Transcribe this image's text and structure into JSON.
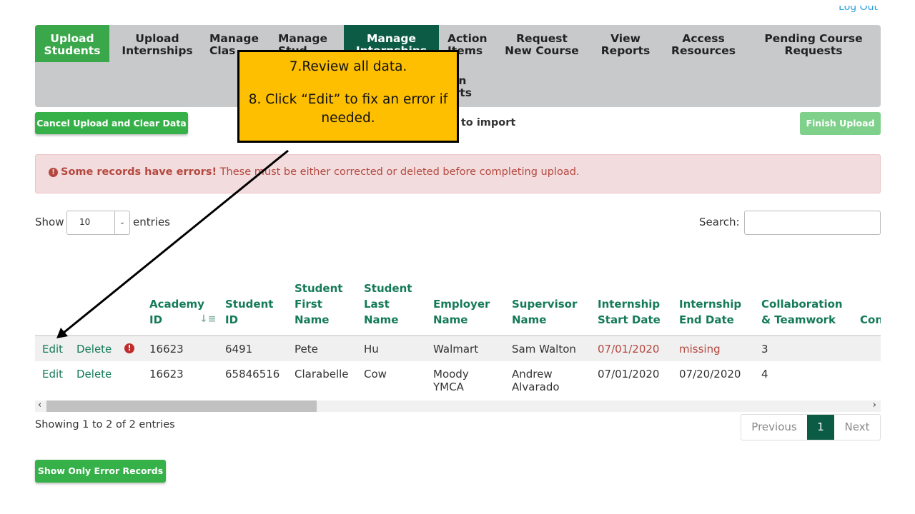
{
  "header": {
    "logout": "Log Out"
  },
  "nav": [
    {
      "label": "Upload\nStudents",
      "state": "active"
    },
    {
      "label": "Upload\nInternships"
    },
    {
      "label": "Manage\nClas"
    },
    {
      "label": "Manage\nStud"
    },
    {
      "label": "Manage\nInternships",
      "state": "current"
    },
    {
      "label": "Action\nItems"
    },
    {
      "label": "Request\nNew Course"
    },
    {
      "label": "View\nReports"
    },
    {
      "label": "Access\nResources"
    },
    {
      "label": "Pending Course\nRequests"
    },
    {
      "label": "nin\norts"
    }
  ],
  "toolbar": {
    "cancel_label": "Cancel Upload and Clear Data",
    "status_text": "dy to import",
    "finish_label": "Finish Upload"
  },
  "alert": {
    "bold": "Some records have errors!",
    "text": " These must be either corrected or deleted before completing upload."
  },
  "length_control": {
    "show_label": "Show",
    "value": "10",
    "entries_label": "entries"
  },
  "search": {
    "label": "Search:",
    "value": ""
  },
  "table": {
    "headers": [
      "Academy ID",
      "Student ID",
      "Student First Name",
      "Student Last Name",
      "Employer Name",
      "Supervisor Name",
      "Internship Start Date",
      "Internship End Date",
      "Collaboration & Teamwork",
      "Con"
    ],
    "rows": [
      {
        "edit": "Edit",
        "delete": "Delete",
        "has_error": true,
        "academy_id": "16623",
        "student_id": "6491",
        "first": "Pete",
        "last": "Hu",
        "employer": "Walmart",
        "supervisor": "Sam Walton",
        "start": "07/01/2020",
        "end": "missing",
        "collab": "3"
      },
      {
        "edit": "Edit",
        "delete": "Delete",
        "has_error": false,
        "academy_id": "16623",
        "student_id": "65846516",
        "first": "Clarabelle",
        "last": "Cow",
        "employer": "Moody YMCA",
        "supervisor": "Andrew Alvarado",
        "start": "07/01/2020",
        "end": "07/20/2020",
        "collab": "4"
      }
    ]
  },
  "footer": {
    "info": "Showing 1 to 2 of 2 entries",
    "previous": "Previous",
    "page": "1",
    "next": "Next",
    "show_errors_label": "Show Only Error Records"
  },
  "callout": {
    "line1": "7.Review all data.",
    "line2": "8. Click “Edit” to fix an error if needed."
  },
  "colors": {
    "brand_green": "#36b14a",
    "nav_current": "#0c5c45",
    "link": "#157a5a",
    "error": "#b4483f",
    "callout": "#fdbf00"
  }
}
